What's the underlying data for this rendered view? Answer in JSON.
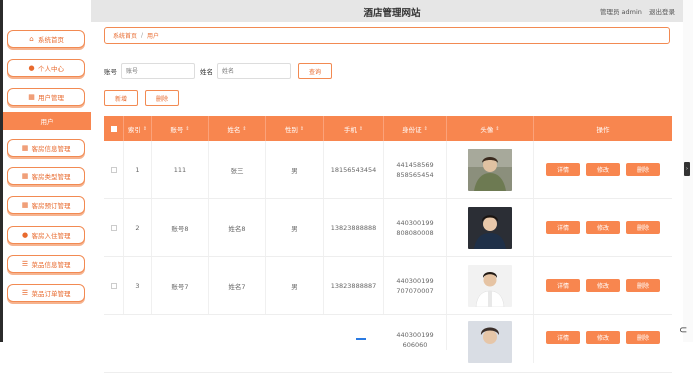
{
  "header": {
    "site_title": "酒店管理网站",
    "admin_label": "管理员 admin",
    "logout": "退出登录"
  },
  "sidebar": {
    "items": [
      {
        "label": "系统首页",
        "icon": "home-icon"
      },
      {
        "label": "个人中心",
        "icon": "person-icon"
      },
      {
        "label": "用户管理",
        "icon": "grid-icon"
      },
      {
        "label": "客房信息管理",
        "icon": "grid-icon"
      },
      {
        "label": "客房类型管理",
        "icon": "grid-icon"
      },
      {
        "label": "客房预订管理",
        "icon": "grid-icon"
      },
      {
        "label": "客房入住管理",
        "icon": "pin-icon"
      },
      {
        "label": "菜品信息管理",
        "icon": "list-icon"
      },
      {
        "label": "菜品订单管理",
        "icon": "list-icon"
      }
    ],
    "active_sub": "用户"
  },
  "breadcrumb": {
    "home": "系统首页",
    "separator": "/",
    "current": "用户"
  },
  "search": {
    "account_label": "账号",
    "account_placeholder": "账号",
    "name_label": "姓名",
    "name_placeholder": "姓名",
    "query_button": "查询"
  },
  "actions": {
    "add": "新增",
    "delete": "删除"
  },
  "table": {
    "columns": [
      "索引",
      "账号",
      "姓名",
      "性别",
      "手机",
      "身份证",
      "头像",
      "操作"
    ],
    "rows": [
      {
        "index": "1",
        "account": "111",
        "name": "张三",
        "gender": "男",
        "phone": "18156543454",
        "idcard": "441458569858565454"
      },
      {
        "index": "2",
        "account": "账号8",
        "name": "姓名8",
        "gender": "男",
        "phone": "13823888888",
        "idcard": "440300199808080008"
      },
      {
        "index": "3",
        "account": "账号7",
        "name": "姓名7",
        "gender": "男",
        "phone": "13823888887",
        "idcard": "440300199707070007"
      },
      {
        "index": "",
        "account": "",
        "name": "",
        "gender": "",
        "phone": "",
        "idcard": "440300199606060"
      }
    ],
    "row_buttons": {
      "detail": "详情",
      "edit": "修改",
      "delete": "删除"
    }
  },
  "colors": {
    "accent": "#f8864f",
    "accent_border": "#f28a52",
    "topbar": "#e6e6e6"
  }
}
